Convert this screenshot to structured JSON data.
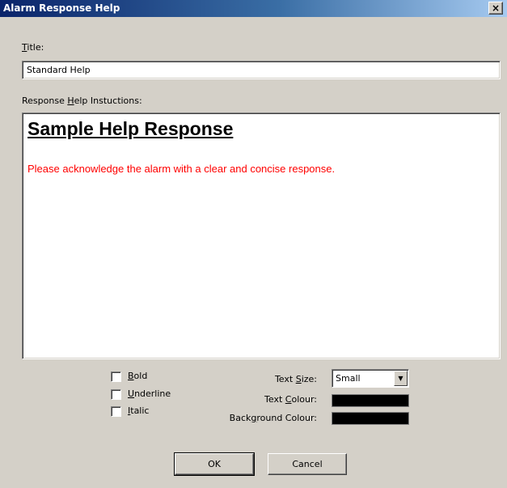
{
  "window": {
    "title": "Alarm Response Help",
    "close_glyph": "×"
  },
  "title_field": {
    "label": "Title:",
    "mnemonic": "T",
    "label_rest": "itle:",
    "value": "Standard Help"
  },
  "instructions": {
    "label_pre": "Response ",
    "mnemonic": "H",
    "label_post": "elp Instuctions:",
    "heading": "Sample Help Response",
    "body": "Please acknowledge the alarm with a clear and concise response."
  },
  "formatting": {
    "bold": {
      "mnemonic": "B",
      "rest": "old",
      "checked": false
    },
    "underline": {
      "mnemonic": "U",
      "rest": "nderline",
      "checked": false
    },
    "italic": {
      "mnemonic": "I",
      "rest": "talic",
      "checked": false
    }
  },
  "text_size": {
    "pre": "Text ",
    "mnemonic": "S",
    "post": "ize:",
    "value": "Small"
  },
  "text_colour": {
    "pre": "Text ",
    "mnemonic": "C",
    "post": "olour:",
    "color": "#000000"
  },
  "background_colour": {
    "pre": "Back",
    "mnemonic": "g",
    "post": "round Colour:",
    "color": "#000000"
  },
  "buttons": {
    "ok": "OK",
    "cancel": "Cancel"
  },
  "colors": {
    "heading_text": "#000000",
    "body_text": "#ff0000",
    "titlebar": "#0a246a"
  }
}
